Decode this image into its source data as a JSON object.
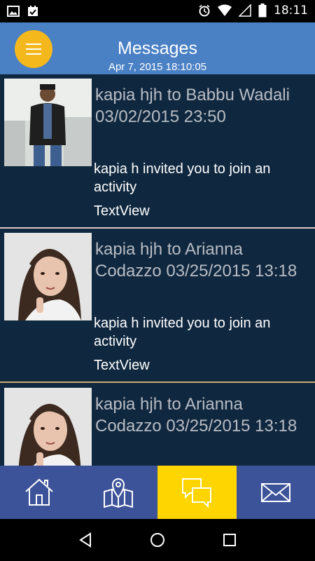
{
  "status_bar": {
    "time": "18:11"
  },
  "app_bar": {
    "title": "Messages",
    "date": "Apr 7, 2015 18:10:05"
  },
  "messages": [
    {
      "title": "kapia hjh to Babbu Wadali 03/02/2015 23:50",
      "body": "kapia h  invited you to join an activity",
      "footer": "TextView"
    },
    {
      "title": "kapia hjh to Arianna Codazzo 03/25/2015 13:18",
      "body": "kapia h  invited you to join an activity",
      "footer": "TextView"
    },
    {
      "title": "kapia hjh to Arianna Codazzo 03/25/2015 13:18",
      "body": "",
      "footer": ""
    }
  ],
  "bottom_nav": [
    {
      "icon": "home-icon",
      "active": false
    },
    {
      "icon": "map-icon",
      "active": false
    },
    {
      "icon": "chat-icon",
      "active": true
    },
    {
      "icon": "mail-icon",
      "active": false
    }
  ],
  "colors": {
    "app_bar": "#4a80c4",
    "menu_button": "#f5b81c",
    "list_bg": "#10283f",
    "bottom_nav": "#3c5399",
    "active_tab": "#ffd500"
  }
}
